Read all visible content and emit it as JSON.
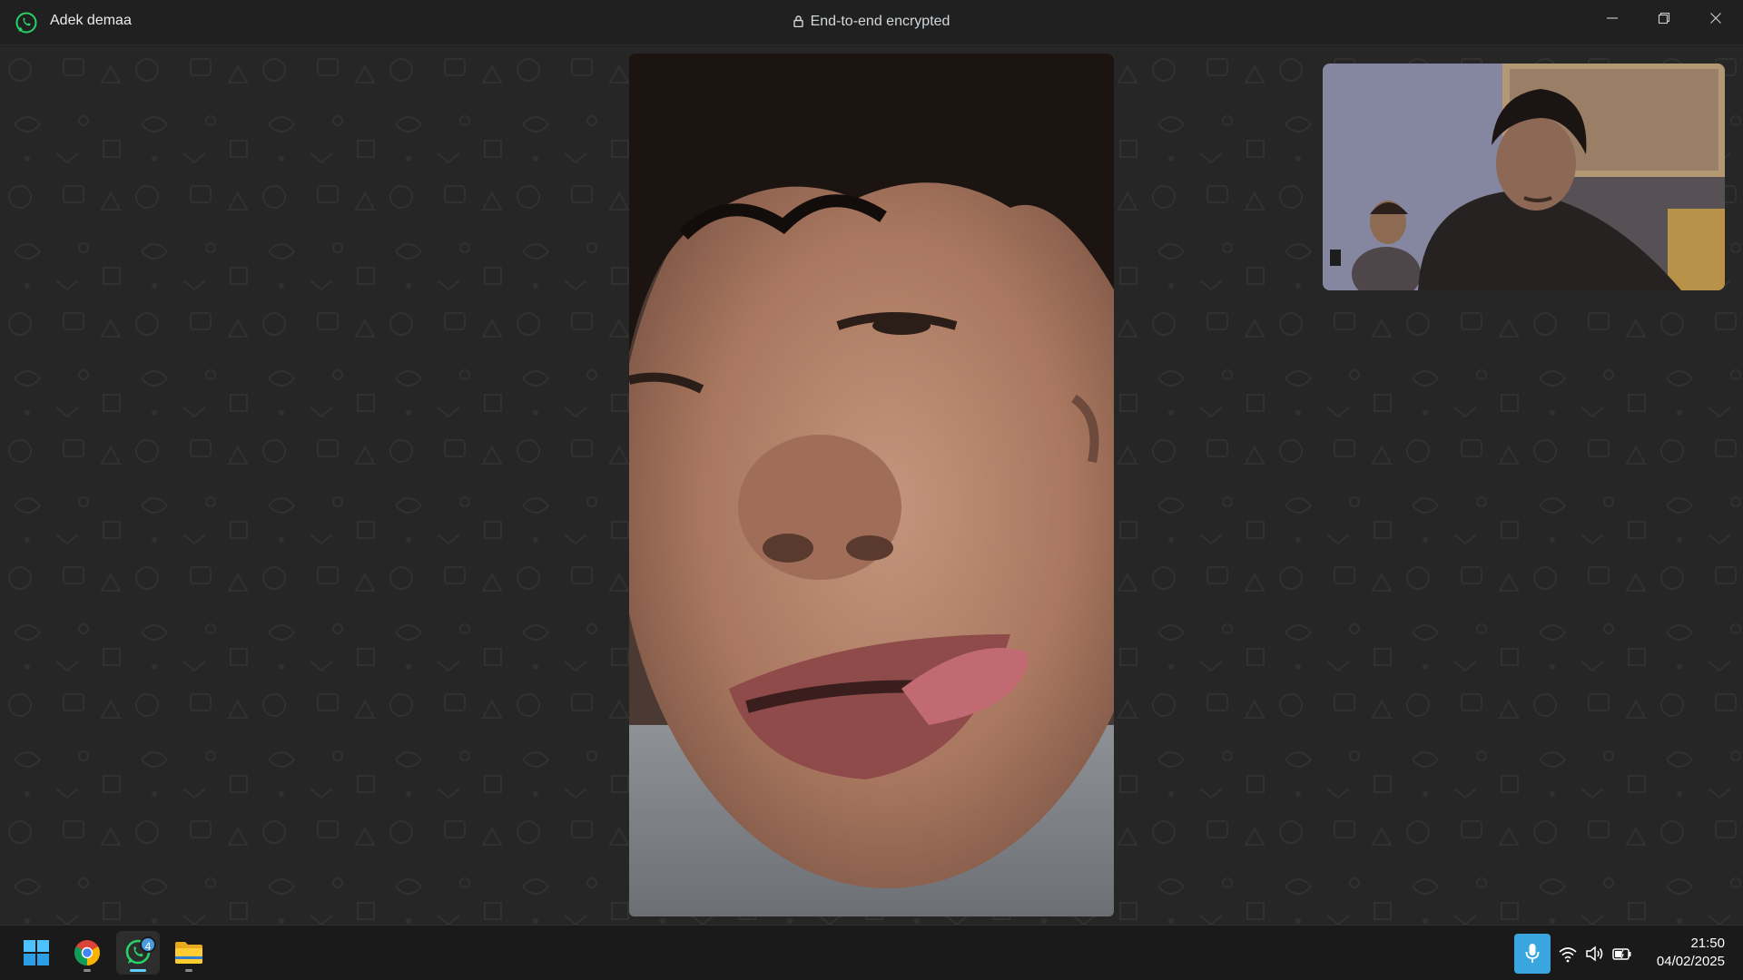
{
  "titlebar": {
    "caller_name": "Adek demaa",
    "encryption_label": "End-to-end encrypted",
    "app_icon": "whatsapp-icon",
    "window_controls": [
      "minimize-icon",
      "restore-icon",
      "close-icon"
    ]
  },
  "call": {
    "main_video": "remote-participant-video",
    "self_view": "local-camera-preview"
  },
  "taskbar": {
    "apps": [
      {
        "name": "start",
        "icon": "windows-start-icon"
      },
      {
        "name": "chrome",
        "icon": "chrome-icon"
      },
      {
        "name": "whatsapp",
        "icon": "whatsapp-icon",
        "badge": "4",
        "active": true
      },
      {
        "name": "file-explorer",
        "icon": "folder-icon"
      }
    ],
    "tray": [
      "microphone-icon",
      "wifi-icon",
      "volume-icon",
      "battery-icon"
    ],
    "time": "21:50",
    "date": "04/02/2025"
  },
  "colors": {
    "titlebar": "#202020",
    "call_background": "#262626",
    "whatsapp_green": "#25d366",
    "accent_blue": "#3aa6e0"
  }
}
